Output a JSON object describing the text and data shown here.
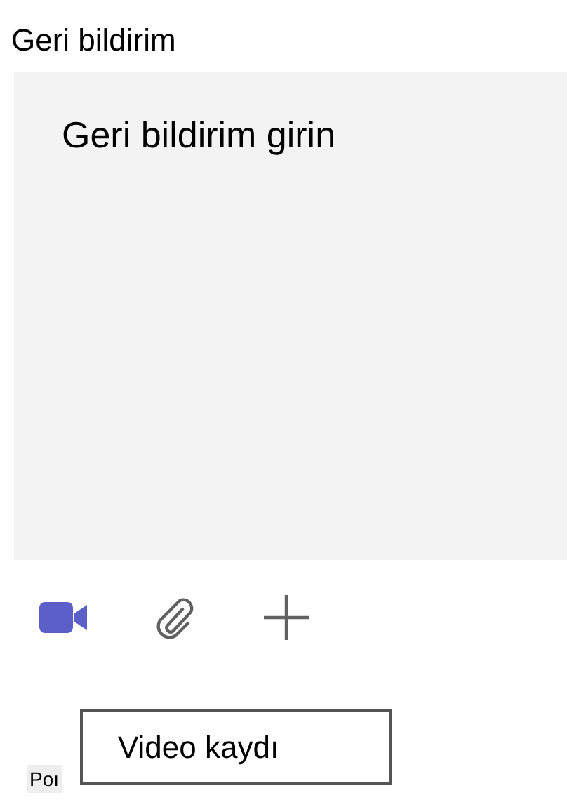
{
  "title": "Geri bildirim",
  "feedback_field": {
    "placeholder": "Geri bildirim girin"
  },
  "toolbar": [
    {
      "kind": "video",
      "active": true
    },
    {
      "kind": "attach",
      "active": false
    },
    {
      "kind": "add",
      "active": false
    }
  ],
  "bottom_label": "Poı",
  "tooltip": "Video kaydı"
}
